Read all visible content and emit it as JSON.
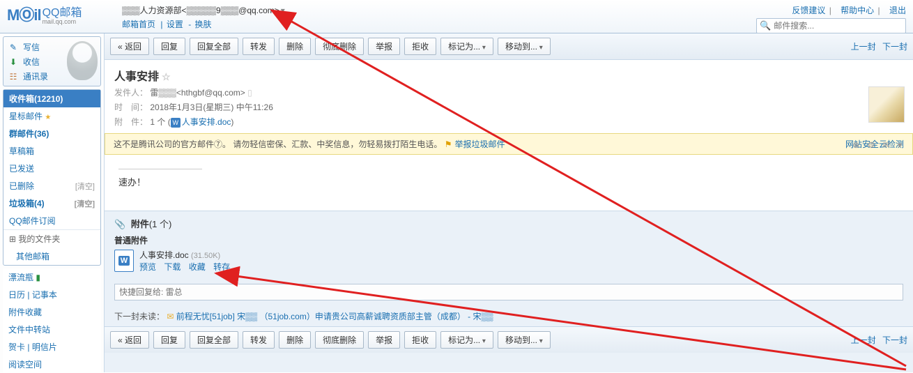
{
  "header": {
    "logo_brand": "MⓄil",
    "logo_cn": "QQ邮箱",
    "logo_domain": "mail.qq.com",
    "user_display": "▒▒▒人力资源部<▒▒▒▒▒9▒▒▒@qq.com>",
    "nav_home": "邮箱首页",
    "nav_settings": "设置",
    "nav_skin": "换肤",
    "right_feedback": "反馈建议",
    "right_help": "帮助中心",
    "right_logout": "退出",
    "search_placeholder": "邮件搜索..."
  },
  "sidebar": {
    "compose": "写信",
    "receive": "收信",
    "contacts": "通讯录",
    "folders": {
      "inbox": "收件箱(12210)",
      "star": "星标邮件",
      "group": "群邮件(36)",
      "draft": "草稿箱",
      "sent": "已发送",
      "deleted": "已删除",
      "trash": "垃圾箱(4)",
      "sub": "QQ邮件订阅",
      "clear": "[清空]"
    },
    "myfiles": "我的文件夹",
    "other_mail": "其他邮箱",
    "extras": {
      "drift": "漂流瓶",
      "calendar": "日历",
      "notebook": "记事本",
      "attach_fav": "附件收藏",
      "file_transfer": "文件中转站",
      "card": "贺卡",
      "postcard": "明信片",
      "read_space": "阅读空间"
    }
  },
  "toolbar": {
    "back": "« 返回",
    "reply": "回复",
    "reply_all": "回复全部",
    "forward": "转发",
    "delete": "删除",
    "delete_perm": "彻底删除",
    "report": "举报",
    "reject": "拒收",
    "mark": "标记为...",
    "move": "移动到...",
    "prev": "上一封",
    "next": "下一封"
  },
  "mail": {
    "subject": "人事安排",
    "sender_label": "发件人：",
    "sender": "雷▒▒▒<hthgbf@qq.com>",
    "time_label": "时　间：",
    "time": "2018年1月3日(星期三) 中午11:26",
    "attach_label": "附　件：",
    "attach_count": "1 个",
    "attach_name_inline": "人事安排.doc",
    "body_text": "速办！",
    "reply_placeholder": "快捷回复给: 雷总"
  },
  "warning": {
    "text": "这不是腾讯公司的官方邮件⑦。  请勿轻信密保、汇款、中奖信息，勿轻易拨打陌生电话。",
    "report_spam": "举报垃圾邮件",
    "right": "网站安全云检测"
  },
  "attachment": {
    "section_title": "附件",
    "section_count": "(1 个)",
    "normal": "普通附件",
    "file_name": "人事安排.doc",
    "file_size": "(31.50K)",
    "preview": "预览",
    "download": "下载",
    "favorite": "收藏",
    "transfer": "转存"
  },
  "next_mail": {
    "label": "下一封未读：",
    "subject": "前程无忧[51job] 宋▒▒  （51job.com）申请贵公司高薪诚聘资质部主管（成都） - 宋▒▒"
  }
}
